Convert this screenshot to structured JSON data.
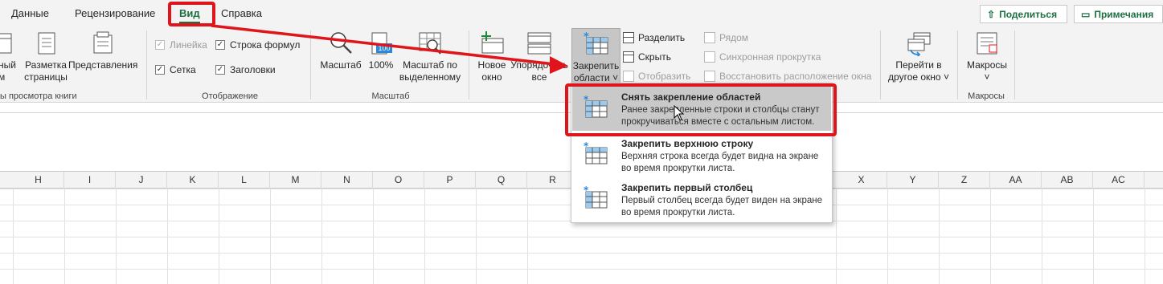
{
  "tabs": [
    {
      "label": "Данные"
    },
    {
      "label": "Рецензирование"
    },
    {
      "label": "Вид"
    },
    {
      "label": "Справка"
    }
  ],
  "header_buttons": {
    "share": "Поделиться",
    "comments": "Примечания"
  },
  "ribbon": {
    "views_group": {
      "partial_label_1": "ный",
      "partial_label_2": "м",
      "page_layout": [
        "Разметка",
        "страницы"
      ],
      "custom_views": "Представления",
      "group_label": "ы просмотра книги"
    },
    "show_group": {
      "ruler": "Линейка",
      "formula_bar": "Строка формул",
      "gridlines": "Сетка",
      "headings": "Заголовки",
      "group_label": "Отображение",
      "ruler_checked": true,
      "formula_bar_checked": true,
      "gridlines_checked": true,
      "headings_checked": true
    },
    "zoom_group": {
      "zoom": "Масштаб",
      "zoom_100": "100%",
      "zoom_100_icon_text": "100",
      "zoom_selection": [
        "Масштаб по",
        "выделенному"
      ],
      "group_label": "Масштаб"
    },
    "window_group": {
      "new_window": [
        "Новое",
        "окно"
      ],
      "arrange_all": [
        "Упорядочить",
        "все"
      ],
      "freeze_panes": [
        "Закрепить",
        "области ˅"
      ],
      "split": "Разделить",
      "hide": "Скрыть",
      "unhide": "Отобразить",
      "side_by_side": "Рядом",
      "sync_scroll": "Синхронная прокрутка",
      "reset_position": "Восстановить расположение окна",
      "switch_windows": [
        "Перейти в",
        "другое окно ˅"
      ]
    },
    "macros_group": {
      "macros": [
        "Макросы",
        "˅"
      ],
      "group_label": "Макросы"
    }
  },
  "columns": [
    "H",
    "I",
    "J",
    "K",
    "L",
    "M",
    "N",
    "O",
    "P",
    "Q",
    "R",
    "X",
    "Y",
    "Z",
    "AA",
    "AB",
    "AC"
  ],
  "freeze_menu": [
    {
      "title": "Снять закрепление областей",
      "desc": "Ранее закрепленные строки и столбцы станут прокручиваться вместе с остальным листом."
    },
    {
      "title": "Закрепить верхнюю строку",
      "desc": "Верхняя строка всегда будет видна на экране во время прокрутки листа."
    },
    {
      "title": "Закрепить первый столбец",
      "desc": "Первый столбец всегда будет виден на экране во время прокрутки листа."
    }
  ],
  "colors": {
    "accent": "#1d6f42",
    "annotation": "#e0141b",
    "icon_blue": "#2b88d8"
  },
  "icons": {
    "share": "share-icon",
    "comments": "comment-icon",
    "freeze": "freeze-panes-icon"
  }
}
